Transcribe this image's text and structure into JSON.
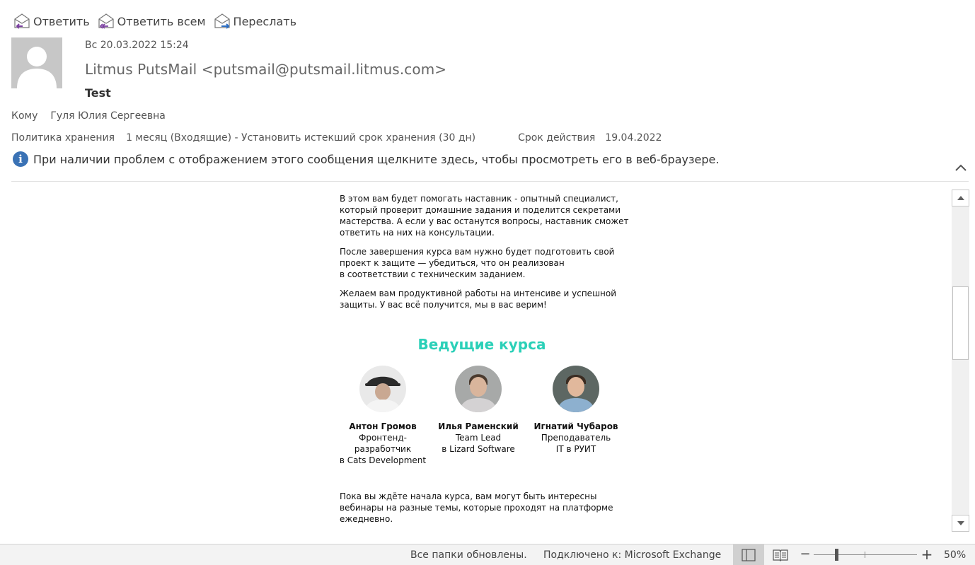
{
  "toolbar": {
    "reply": "Ответить",
    "reply_all": "Ответить всем",
    "forward": "Переслать"
  },
  "message": {
    "date": "Вс 20.03.2022 15:24",
    "sender": "Litmus PutsMail <putsmail@putsmail.litmus.com>",
    "subject": "Test",
    "to_label": "Кому",
    "to_value": "Гуля Юлия Сергеевна",
    "policy_label": "Политика хранения",
    "policy_value": "1 месяц (Входящие) - Установить истекший срок хранения (30 дн)",
    "expiry_label": "Срок действия",
    "expiry_value": "19.04.2022",
    "info_text": "При наличии проблем с отображением этого сообщения щелкните здесь, чтобы просмотреть его в веб-браузере."
  },
  "body": {
    "paragraphs": [
      "В этом вам будет помогать наставник - опытный специалист,\nкоторый проверит домашние задания и поделится секретами\nмастерства. А если у вас останутся вопросы, наставник сможет\nответить на них на консультации.",
      "После завершения курса вам нужно будет подготовить свой\nпроект к защите — убедиться, что он реализован\nв соответствии с техническим заданием.",
      "Желаем вам продуктивной работы на интенсиве и успешной\nзащиты. У вас всё получится, мы в вас верим!"
    ],
    "heading": "Ведущие курса",
    "mentors": [
      {
        "name": "Антон Громов",
        "role": "Фронтенд-\nразработчик\nв Cats Development"
      },
      {
        "name": "Илья Раменский",
        "role": "Team Lead\nв Lizard Software"
      },
      {
        "name": "Игнатий Чубаров",
        "role": "Преподаватель\nIT в РУИТ"
      }
    ],
    "closing": "Пока вы ждёте начала курса, вам могут быть интересны\nвебинары на разные темы, которые проходят на платформе\nежедневно."
  },
  "statusbar": {
    "status": "Все папки обновлены.",
    "connection": "Подключено к: Microsoft Exchange",
    "zoom": "50%"
  },
  "icons": {
    "reply": "reply-envelope-icon",
    "reply_all": "reply-all-envelope-icon",
    "forward": "forward-envelope-icon",
    "info": "info-icon",
    "collapse": "chevron-up-icon"
  },
  "colors": {
    "heading_accent": "#2bd0b8",
    "info_blue": "#3a72b5",
    "reply_arrow": "#7b3fa0",
    "forward_arrow": "#2e6fc4"
  }
}
